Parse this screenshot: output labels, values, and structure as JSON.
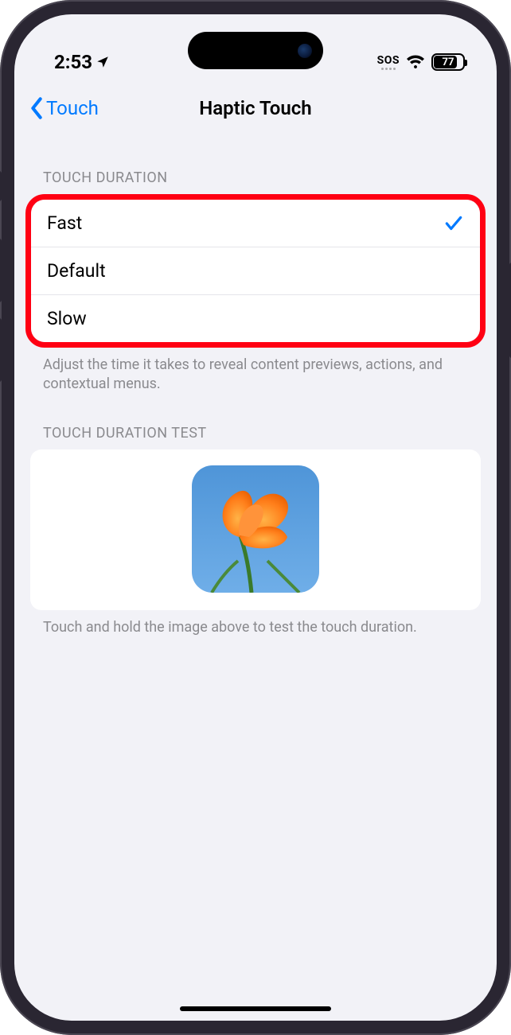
{
  "status": {
    "time": "2:53",
    "sos": "SOS",
    "battery": "77"
  },
  "nav": {
    "back_label": "Touch",
    "title": "Haptic Touch"
  },
  "touch_duration": {
    "header": "TOUCH DURATION",
    "options": [
      {
        "label": "Fast",
        "selected": true
      },
      {
        "label": "Default",
        "selected": false
      },
      {
        "label": "Slow",
        "selected": false
      }
    ],
    "footer": "Adjust the time it takes to reveal content previews, actions, and contextual menus."
  },
  "test": {
    "header": "TOUCH DURATION TEST",
    "footer": "Touch and hold the image above to test the touch duration."
  }
}
